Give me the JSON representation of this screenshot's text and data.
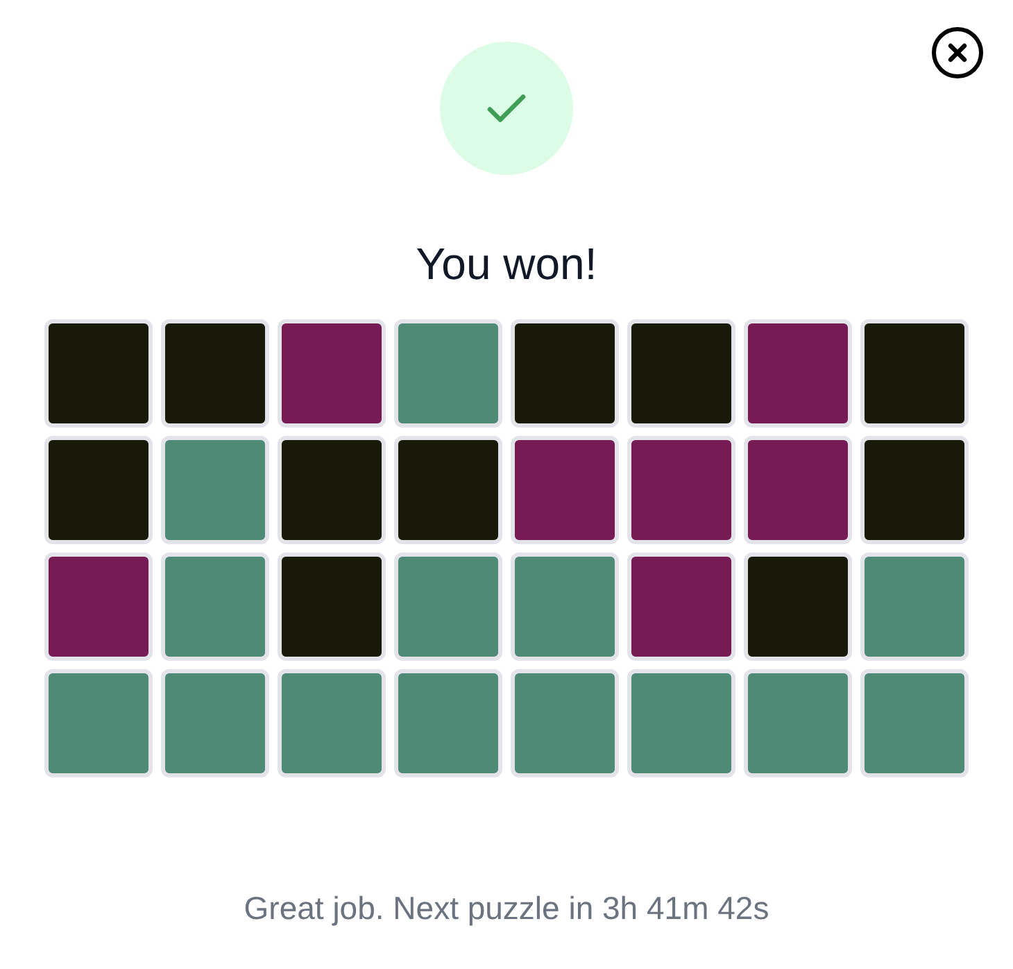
{
  "title": "You won!",
  "grid": [
    [
      {
        "color": "#19190a"
      },
      {
        "color": "#19190a"
      },
      {
        "color": "#761a54"
      },
      {
        "color": "#4e8a76"
      },
      {
        "color": "#19190a"
      },
      {
        "color": "#19190a"
      },
      {
        "color": "#761a54"
      },
      {
        "color": "#19190a"
      }
    ],
    [
      {
        "color": "#19190a"
      },
      {
        "color": "#4e8a76"
      },
      {
        "color": "#19190a"
      },
      {
        "color": "#19190a"
      },
      {
        "color": "#761a54"
      },
      {
        "color": "#761a54"
      },
      {
        "color": "#761a54"
      },
      {
        "color": "#19190a"
      }
    ],
    [
      {
        "color": "#761a54"
      },
      {
        "color": "#4e8a76"
      },
      {
        "color": "#19190a"
      },
      {
        "color": "#4e8a76"
      },
      {
        "color": "#4e8a76"
      },
      {
        "color": "#761a54"
      },
      {
        "color": "#19190a"
      },
      {
        "color": "#4e8a76"
      }
    ],
    [
      {
        "color": "#4e8a76"
      },
      {
        "color": "#4e8a76"
      },
      {
        "color": "#4e8a76"
      },
      {
        "color": "#4e8a76"
      },
      {
        "color": "#4e8a76"
      },
      {
        "color": "#4e8a76"
      },
      {
        "color": "#4e8a76"
      },
      {
        "color": "#4e8a76"
      }
    ]
  ],
  "footer": "Great job. Next puzzle in 3h 41m 42s"
}
